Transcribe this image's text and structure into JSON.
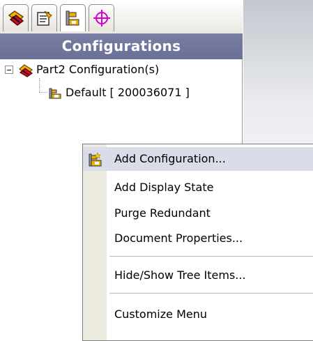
{
  "pane": {
    "header_title": "Configurations",
    "tabs": [
      {
        "icon": "feature-manager-icon",
        "active": false
      },
      {
        "icon": "property-manager-icon",
        "active": false
      },
      {
        "icon": "configuration-manager-icon",
        "active": true
      },
      {
        "icon": "dimxpert-manager-icon",
        "active": false
      }
    ]
  },
  "tree": {
    "root_label": "Part2 Configuration(s)",
    "child_label": "Default [ 200036071 ]"
  },
  "context_menu": {
    "items": [
      {
        "label": "Add Configuration...",
        "icon": "add-configuration-icon"
      },
      {
        "label": "Add Display State"
      },
      {
        "label": "Purge Redundant"
      },
      {
        "label": "Document Properties..."
      },
      {
        "label": "Hide/Show Tree Items..."
      },
      {
        "label": "Customize Menu"
      }
    ]
  },
  "colors": {
    "header_bg": "#6e7399",
    "menu_gutter": "#edeae0",
    "menu_highlight": "#d8dde8"
  }
}
